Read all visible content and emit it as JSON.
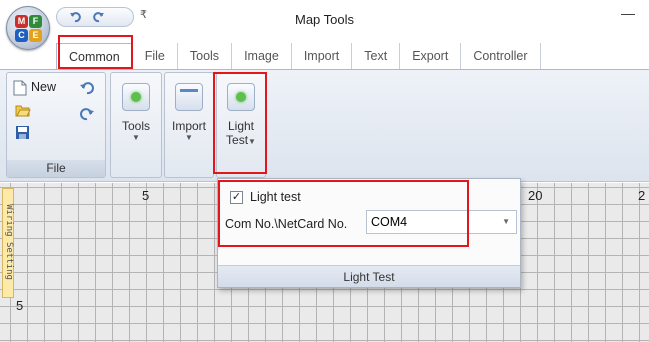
{
  "window": {
    "title": "Map Tools",
    "qat_dropdown": "₹",
    "minimize": "—"
  },
  "orb": {
    "letters": [
      "M",
      "F",
      "C",
      "E"
    ],
    "colors": [
      "#c9302c",
      "#2f8a3a",
      "#1f5fbf",
      "#e3a21a"
    ]
  },
  "tabs": [
    {
      "label": "Common"
    },
    {
      "label": "File"
    },
    {
      "label": "Tools"
    },
    {
      "label": "Image"
    },
    {
      "label": "Import"
    },
    {
      "label": "Text"
    },
    {
      "label": "Export"
    },
    {
      "label": "Controller"
    }
  ],
  "ribbon": {
    "file_group": {
      "label": "File",
      "new_label": "New"
    },
    "tools_btn": {
      "label": "Tools",
      "arrow": "▼"
    },
    "import_btn": {
      "label": "Import",
      "arrow": "▼"
    },
    "light_test_btn": {
      "label_line1": "Light",
      "label_line2": "Test",
      "arrow": "▼"
    }
  },
  "canvas": {
    "side_tab_label": "Wiring Setting",
    "ruler_top": [
      "5",
      "20",
      "2"
    ],
    "ruler_left": [
      "5"
    ]
  },
  "light_test_popup": {
    "checkbox_label": "Light test",
    "checkbox_checked": true,
    "check_mark": "✓",
    "com_label": "Com No.\\NetCard No.",
    "com_value": "COM4",
    "dropdown_arrow": "▼",
    "footer": "Light Test"
  },
  "colors": {
    "highlight": "#e2161b",
    "green_light": "#5fbf4d"
  }
}
